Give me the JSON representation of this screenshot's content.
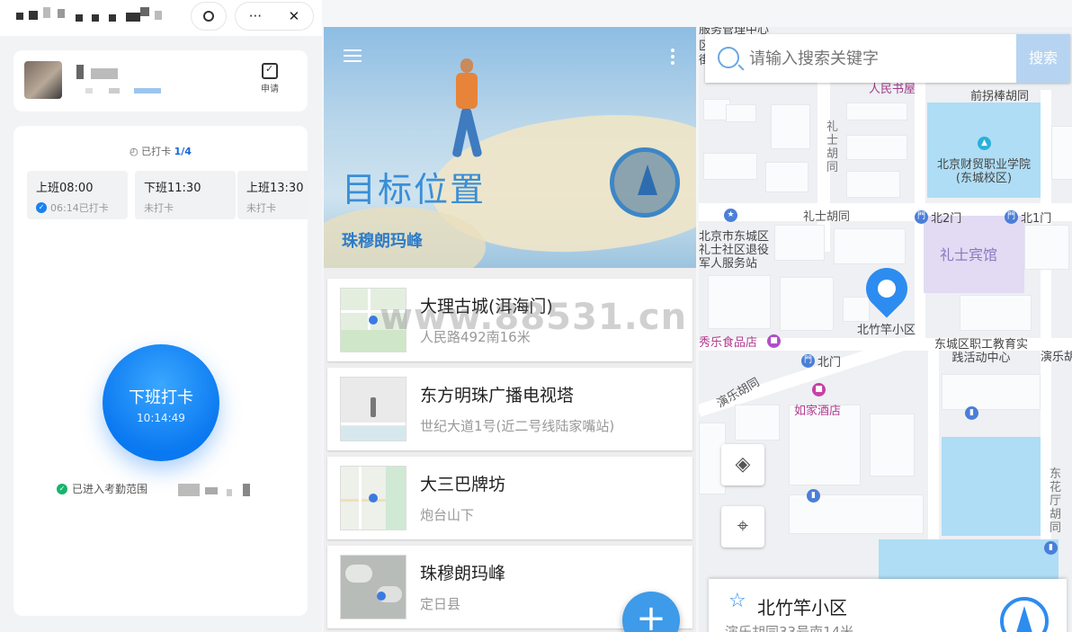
{
  "attendance": {
    "apply_label": "申请",
    "more_label": "···",
    "close_label": "✕",
    "status_prefix": "已打卡",
    "status_count": "1/4",
    "shifts": [
      {
        "time": "上班08:00",
        "status": "06:14已打卡",
        "checked": true
      },
      {
        "time": "下班11:30",
        "status": "未打卡",
        "checked": false
      },
      {
        "time": "上班13:30",
        "status": "未打卡",
        "checked": false
      }
    ],
    "punch_label": "下班打卡",
    "punch_time": "10:14:49",
    "range_text": "已进入考勤范围"
  },
  "target": {
    "title": "目标位置",
    "subtitle": "珠穆朗玛峰",
    "watermark": "www.88531.cn",
    "fab_label": "+",
    "places": [
      {
        "name": "大理古城(洱海门)",
        "address": "人民路492南16米"
      },
      {
        "name": "东方明珠广播电视塔",
        "address": "世纪大道1号(近二号线陆家嘴站)"
      },
      {
        "name": "大三巴牌坊",
        "address": "炮台山下"
      },
      {
        "name": "珠穆朗玛峰",
        "address": "定日县"
      }
    ]
  },
  "map": {
    "search_placeholder": "请输入搜索关键字",
    "search_button": "搜索",
    "labels": {
      "top_cut": "服务管理中心",
      "bookstore": "人民书屋",
      "lane_top": "前拐棒胡同",
      "lishi_v": "礼士胡同",
      "college": "北京财贸职业学院(东城校区)",
      "lishi_road": "礼士胡同",
      "north2": "北2门",
      "north1": "北1门",
      "veterans": "北京市东城区礼士社区退役军人服务站",
      "hotel": "礼士宾馆",
      "community": "北竹竿小区",
      "shop": "秀乐食品店",
      "north_gate": "北门",
      "workers": "东城区职工教育实践活动中心",
      "yanle": "演乐胡",
      "yanle_road": "演乐胡同",
      "rujia": "如家酒店",
      "dongsi": "东花厅胡同",
      "left_cut1": "区",
      "left_cut2": "街"
    },
    "bottom_name": "北竹竿小区",
    "bottom_address": "演乐胡同33号南14米"
  }
}
